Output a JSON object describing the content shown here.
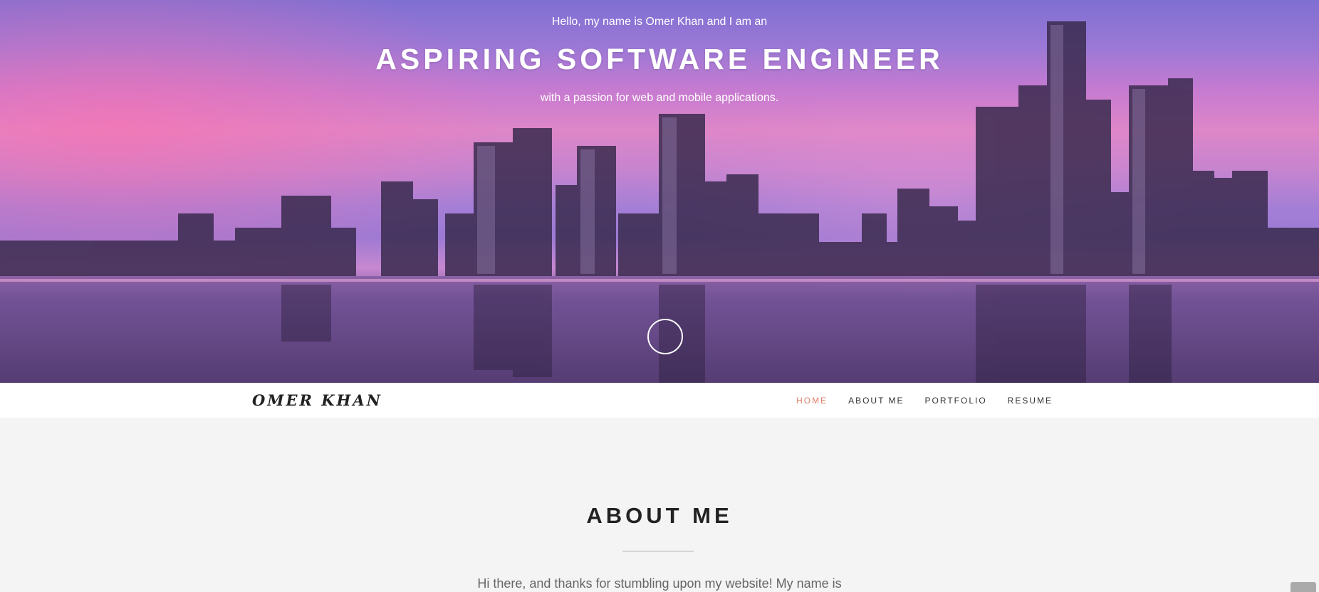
{
  "hero": {
    "intro": "Hello, my name is Omer Khan and I am an",
    "title": "ASPIRING SOFTWARE ENGINEER",
    "subtitle": "with a passion for web and mobile applications.",
    "scroll_icon": "chevron-down-circle-icon"
  },
  "navbar": {
    "brand": "OMER KHAN",
    "links": [
      {
        "label": "HOME",
        "active": true
      },
      {
        "label": "ABOUT ME",
        "active": false
      },
      {
        "label": "PORTFOLIO",
        "active": false
      },
      {
        "label": "RESUME",
        "active": false
      }
    ]
  },
  "about": {
    "heading": "ABOUT ME",
    "intro_text": "Hi there, and thanks for stumbling upon my website! My name is"
  },
  "colors": {
    "accent": "#e07f6a",
    "nav_bg": "#ffffff",
    "page_bg": "#f4f4f4",
    "heading": "#222222"
  }
}
